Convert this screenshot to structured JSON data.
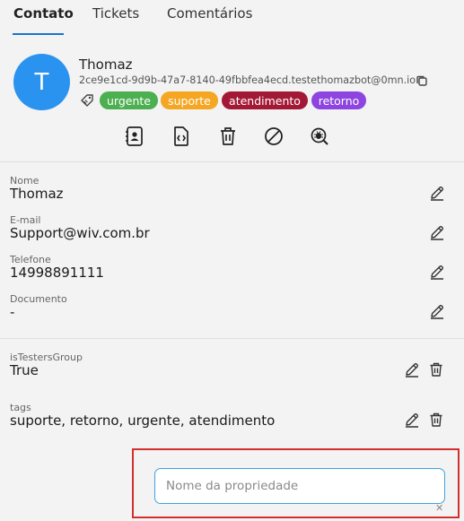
{
  "tabs": [
    {
      "label": "Contato"
    },
    {
      "label": "Tickets"
    },
    {
      "label": "Comentários"
    }
  ],
  "contact": {
    "avatar_letter": "T",
    "name": "Thomaz",
    "id": "2ce9e1cd-9d9b-47a7-8140-49fbbfea4ecd.testethomazbot@0mn.io"
  },
  "tags": [
    {
      "label": "urgente",
      "color": "#4caf50"
    },
    {
      "label": "suporte",
      "color": "#f5a623"
    },
    {
      "label": "atendimento",
      "color": "#a31835"
    },
    {
      "label": "retorno",
      "color": "#8e44e0"
    }
  ],
  "actions": [
    {
      "icon": "contact-card-icon"
    },
    {
      "icon": "code-file-icon"
    },
    {
      "icon": "trash-icon"
    },
    {
      "icon": "block-icon"
    },
    {
      "icon": "bug-search-icon"
    }
  ],
  "fields": [
    {
      "label": "Nome",
      "value": "Thomaz"
    },
    {
      "label": "E-mail",
      "value": "Support@wiv.com.br"
    },
    {
      "label": "Telefone",
      "value": "14998891111"
    },
    {
      "label": "Documento",
      "value": "-"
    }
  ],
  "custom_fields": [
    {
      "label": "isTestersGroup",
      "value": "True"
    },
    {
      "label": "tags",
      "value": "suporte, retorno, urgente, atendimento"
    }
  ],
  "new_property": {
    "placeholder": "Nome da propriedade",
    "close_label": "✕"
  },
  "colors": {
    "accent": "#1a73c9",
    "avatar": "#2a93f0",
    "highlight": "#d32f2f"
  }
}
